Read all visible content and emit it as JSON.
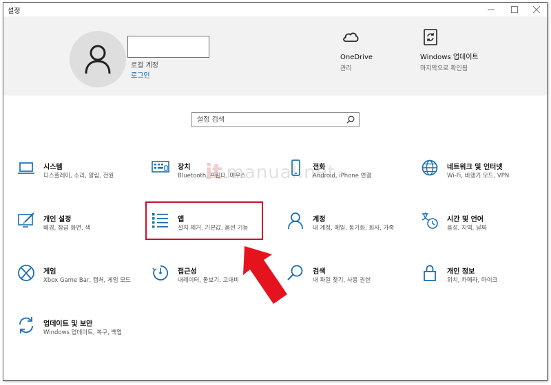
{
  "window": {
    "title": "설정"
  },
  "account": {
    "type": "로컬 계정",
    "signin": "로그인"
  },
  "quick": {
    "onedrive": {
      "title": "OneDrive",
      "sub": "관리"
    },
    "update": {
      "title": "Windows 업데이트",
      "sub": "마지막으로 확인됨"
    }
  },
  "search": {
    "placeholder": "설정 검색"
  },
  "tiles": [
    {
      "label": "시스템",
      "desc": "디스플레이, 소리, 알림, 전원",
      "icon": "laptop-icon"
    },
    {
      "label": "장치",
      "desc": "Bluetooth, 프린터, 마우스",
      "icon": "keyboard-icon"
    },
    {
      "label": "전화",
      "desc": "Android, iPhone 연결",
      "icon": "phone-icon"
    },
    {
      "label": "네트워크 및 인터넷",
      "desc": "Wi-Fi, 비행기 모드, VPN",
      "icon": "globe-icon"
    },
    {
      "label": "개인 설정",
      "desc": "배경, 잠금 화면, 색",
      "icon": "paint-icon"
    },
    {
      "label": "앱",
      "desc": "설치 제거, 기본값, 옵션 기능",
      "icon": "apps-list-icon"
    },
    {
      "label": "계정",
      "desc": "내 계정, 메일, 동기화, 회사, 가족",
      "icon": "person-icon"
    },
    {
      "label": "시간 및 언어",
      "desc": "음성, 지역, 날짜",
      "icon": "time-language-icon"
    },
    {
      "label": "게임",
      "desc": "Xbox Game Bar, 캡처, 게임 모드",
      "icon": "xbox-icon"
    },
    {
      "label": "접근성",
      "desc": "내레이터, 돋보기, 고대비",
      "icon": "accessibility-icon"
    },
    {
      "label": "검색",
      "desc": "내 파일 찾기, 사용 권한",
      "icon": "search-icon"
    },
    {
      "label": "개인 정보",
      "desc": "위치, 카메라, 마이크",
      "icon": "lock-icon"
    },
    {
      "label": "업데이트 및 보안",
      "desc": "Windows 업데이트, 복구, 백업",
      "icon": "update-sync-icon"
    }
  ],
  "watermark": {
    "logo": "it",
    "text": "manual.net"
  },
  "colors": {
    "accent": "#0063b1",
    "highlight": "#c8102e",
    "arrow": "#e5131e",
    "header_bg": "#f2f2f2"
  }
}
